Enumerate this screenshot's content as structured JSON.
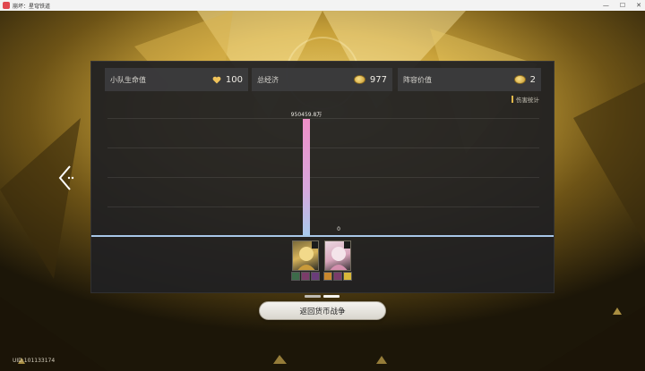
{
  "window": {
    "title": "崩坏：星穹铁道",
    "controls": [
      "—",
      "☐",
      "✕"
    ]
  },
  "stats": [
    {
      "label": "小队生命值",
      "icon": "heart-icon",
      "value": "100"
    },
    {
      "label": "总经济",
      "icon": "coin-icon",
      "value": "977"
    },
    {
      "label": "阵容价值",
      "icon": "coin-icon",
      "value": "2"
    }
  ],
  "damage_stats_label": "伤害统计",
  "chart_data": {
    "type": "bar",
    "categories": [
      "character-1",
      "character-2"
    ],
    "values": [
      9504598000,
      0
    ],
    "value_labels": [
      "950459.8万",
      "0"
    ]
  },
  "return_button_label": "返回货币战争",
  "uid_text": "UID:101133174",
  "colors": {
    "bar_top": "#ef8fc7",
    "bar_bottom": "#a9c9ec",
    "baseline": "#a8c7e8",
    "accent_gold": "#e0b84a"
  }
}
